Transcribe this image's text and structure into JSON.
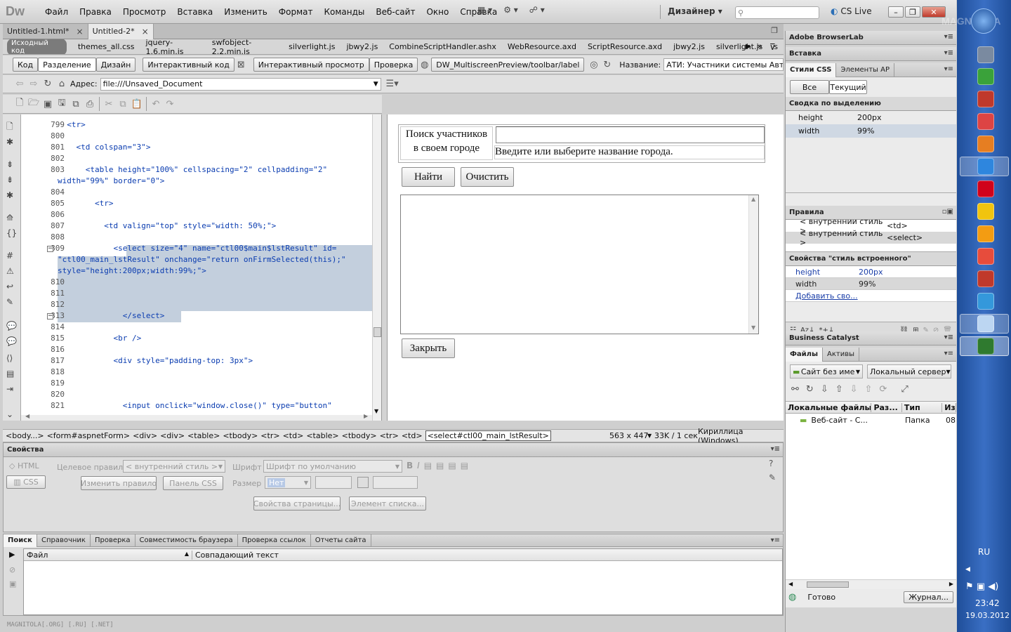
{
  "app": {
    "logo": "Dw",
    "menu": [
      "Файл",
      "Правка",
      "Просмотр",
      "Вставка",
      "Изменить",
      "Формат",
      "Команды",
      "Веб-сайт",
      "Окно",
      "Справка"
    ],
    "workspace": "Дизайнер",
    "cs_live": "CS Live"
  },
  "doc_tabs": [
    {
      "label": "Untitled-1.html*",
      "active": false
    },
    {
      "label": "Untitled-2*",
      "active": true
    }
  ],
  "related_files": {
    "source_label": "Исходный код",
    "files": [
      "themes_all.css",
      "jquery-1.6.min.js",
      "swfobject-2.2.min.js",
      "silverlight.js",
      "jbwy2.js",
      "CombineScriptHandler.ashx",
      "WebResource.axd",
      "ScriptResource.axd",
      "jbwy2.js",
      "silverlight.js",
      "s"
    ]
  },
  "doc_toolbar": {
    "code": "Код",
    "split": "Разделение",
    "design": "Дизайн",
    "live_code": "Интерактивный код",
    "live_view": "Интерактивный просмотр",
    "check": "Проверка",
    "multiscreen": "DW_MultiscreenPreview/toolbar/label",
    "title_label": "Название:",
    "title_value": "АТИ: Участники системы АвтоТранс"
  },
  "browser_nav": {
    "address_label": "Адрес:",
    "address_value": "file:///Unsaved_Document"
  },
  "code": {
    "lines": [
      {
        "n": "799",
        "text": "  <tr>"
      },
      {
        "n": "800",
        "text": ""
      },
      {
        "n": "801",
        "text": "    <td colspan=\"3\">"
      },
      {
        "n": "802",
        "text": ""
      },
      {
        "n": "803",
        "text": "      <table height=\"100%\" cellspacing=\"2\" cellpadding=\"2\""
      },
      {
        "n": "",
        "text": "width=\"99%\" border=\"0\">"
      },
      {
        "n": "804",
        "text": ""
      },
      {
        "n": "805",
        "text": "        <tr>"
      },
      {
        "n": "806",
        "text": ""
      },
      {
        "n": "807",
        "text": "          <td valign=\"top\" style=\"width: 50%;\">"
      },
      {
        "n": "808",
        "text": ""
      },
      {
        "n": "809",
        "text": "            <select size=\"4\" name=\"ctl00$main$lstResult\" id="
      },
      {
        "n": "",
        "text": "\"ctl00_main_lstResult\" onchange=\"return onFirmSelected(this);\""
      },
      {
        "n": "",
        "text": "style=\"height:200px;width:99%;\">"
      },
      {
        "n": "810",
        "text": ""
      },
      {
        "n": "811",
        "text": ""
      },
      {
        "n": "812",
        "text": ""
      },
      {
        "n": "813",
        "text": "              </select>"
      },
      {
        "n": "814",
        "text": ""
      },
      {
        "n": "815",
        "text": "            <br />"
      },
      {
        "n": "816",
        "text": ""
      },
      {
        "n": "817",
        "text": "            <div style=\"padding-top: 3px\">"
      },
      {
        "n": "818",
        "text": ""
      },
      {
        "n": "819",
        "text": ""
      },
      {
        "n": "820",
        "text": ""
      },
      {
        "n": "821",
        "text": "              <input onclick=\"window.close()\" type=\"button\""
      }
    ]
  },
  "design": {
    "search_label_1": "Поиск участников",
    "search_label_2": "в своем городе",
    "city_hint": "Введите или выберите название города.",
    "find_btn": "Найти",
    "clear_btn": "Очистить",
    "close_btn": "Закрыть"
  },
  "status_bar": {
    "tags": [
      "<body...>",
      "<form#aspnetForm>",
      "<div>",
      "<div>",
      "<table>",
      "<tbody>",
      "<tr>",
      "<td>",
      "<table>",
      "<tbody>",
      "<tr>",
      "<td>"
    ],
    "selected_tag": "<select#ctl00_main_lstResult>",
    "size": "563 x 447",
    "speed": "33K / 1 сек",
    "encoding": "Кириллица (Windows)"
  },
  "properties": {
    "title": "Свойства",
    "html": "HTML",
    "css": "CSS",
    "target_rule_label": "Целевое правило",
    "target_rule_value": "< внутренний стиль >",
    "edit_rule": "Изменить правило",
    "css_panel": "Панель CSS",
    "font_label": "Шрифт",
    "font_value": "Шрифт по умолчанию",
    "size_label": "Размер",
    "size_value": "Нет",
    "page_props": "Свойства страницы...",
    "list_item": "Элемент списка..."
  },
  "results": {
    "tabs": [
      "Поиск",
      "Справочник",
      "Проверка",
      "Совместимость браузера",
      "Проверка ссылок",
      "Отчеты сайта"
    ],
    "col_file": "Файл",
    "col_match": "Совпадающий текст",
    "watermark": "MAGNITOLA[.ORG] [.RU] [.NET]"
  },
  "right": {
    "browserlab": "Adobe BrowserLab",
    "insert": "Вставка",
    "css_tab": "Стили CSS",
    "ap_tab": "Элементы AP",
    "all_btn": "Все",
    "current_btn": "Текущий",
    "summary_title": "Сводка по выделению",
    "summary": [
      {
        "prop": "height",
        "value": "200px"
      },
      {
        "prop": "width",
        "value": "99%"
      }
    ],
    "rules_title": "Правила",
    "rules": [
      {
        "rule": "< внутренний стиль >",
        "tag": "<td>"
      },
      {
        "rule": "< внутренний стиль >",
        "tag": "<select>"
      }
    ],
    "props_title": "Свойства \"стиль встроенного\"",
    "props": [
      {
        "prop": "height",
        "value": "200px"
      },
      {
        "prop": "width",
        "value": "99%"
      }
    ],
    "add_prop": "Добавить сво...",
    "business_catalyst": "Business Catalyst",
    "files_tab": "Файлы",
    "assets_tab": "Активы",
    "site_select": "Сайт без име",
    "view_select": "Локальный сервер",
    "files_cols": [
      "Локальные файлы",
      "Раз...",
      "Тип",
      "Из"
    ],
    "files_row": {
      "name": "Веб-сайт - С...",
      "type": "Папка",
      "mod": "08"
    },
    "status": "Готово",
    "log_btn": "Журнал..."
  },
  "taskbar": {
    "lang": "RU",
    "time": "23:42",
    "date": "19.03.2012",
    "wm": "MAGNITOLA"
  },
  "colors": {
    "selection": "#c3cfdd",
    "accent": "#2b6fb6",
    "taskbar": "#2a57a3"
  }
}
